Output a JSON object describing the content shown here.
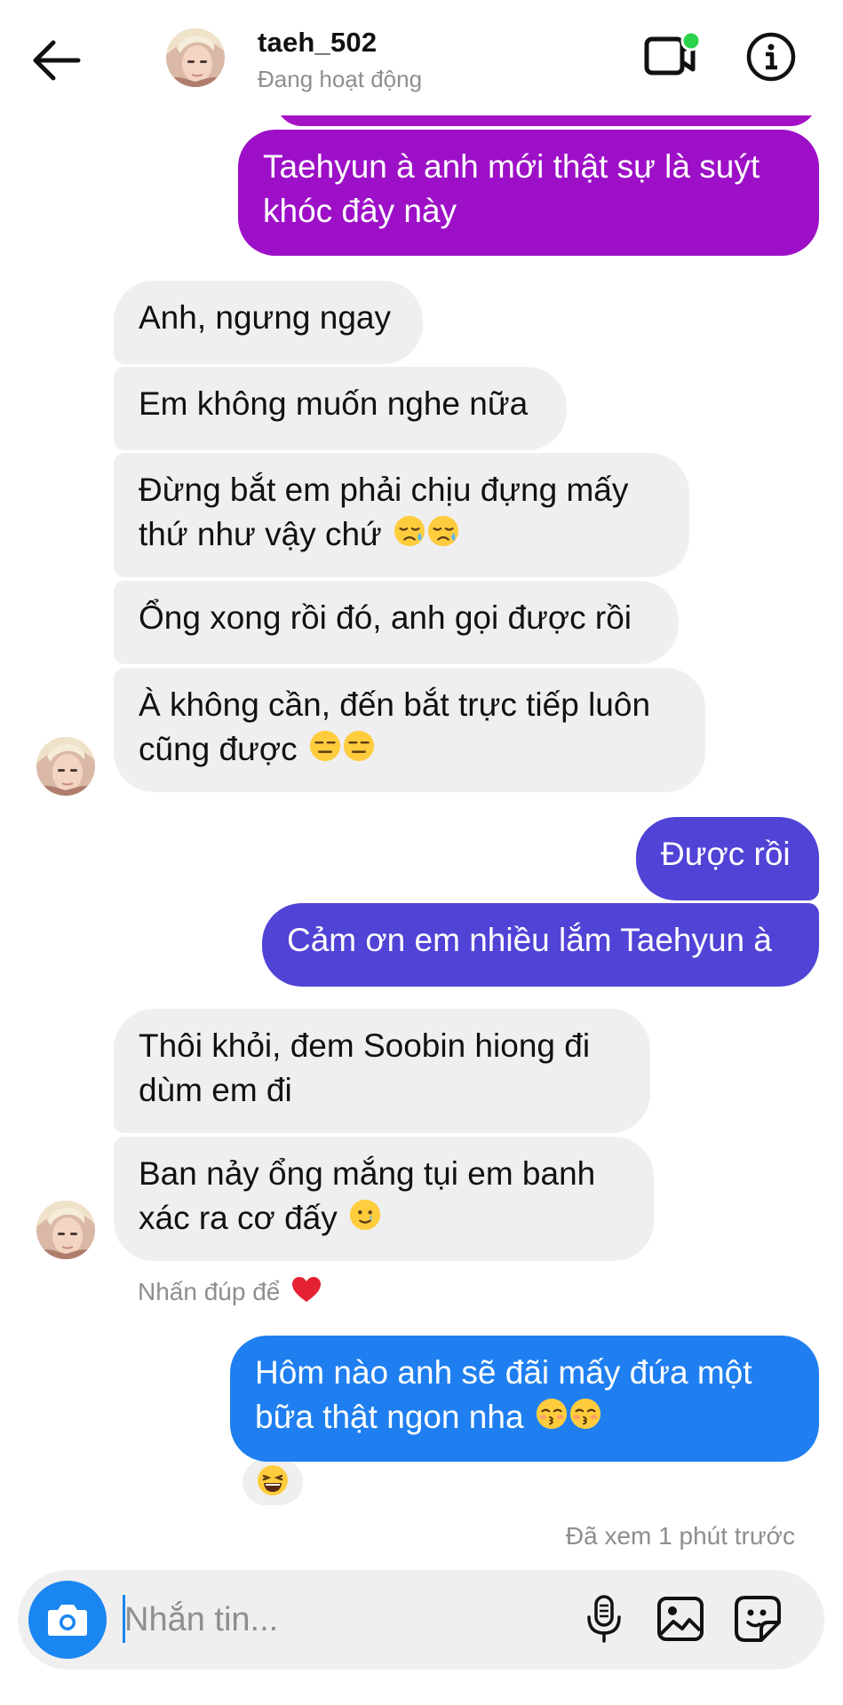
{
  "header": {
    "username": "taeh_502",
    "status": "Đang hoạt động"
  },
  "colors": {
    "incoming": "#efefef",
    "purple": "#9d10c7",
    "indigo": "#5043d6",
    "blue": "#1f7ff0",
    "online_dot": "#2cd34a",
    "camera_button": "#1a86f2"
  },
  "messages": [
    {
      "id": "m1",
      "side": "out",
      "lines": [
        "Taehyun à anh mới thật sự là suýt",
        "khóc đây này"
      ],
      "emoji": []
    },
    {
      "id": "m2",
      "side": "in",
      "lines": [
        "Anh, ngưng ngay"
      ],
      "emoji": []
    },
    {
      "id": "m3",
      "side": "in",
      "lines": [
        "Em không muốn nghe nữa"
      ],
      "emoji": []
    },
    {
      "id": "m4",
      "side": "in",
      "lines": [
        "Đừng bắt em phải chịu đựng mấy",
        "thứ như vậy chứ"
      ],
      "emoji": [
        "sad-sweat-emoji",
        "sad-sweat-emoji"
      ]
    },
    {
      "id": "m5",
      "side": "in",
      "lines": [
        "Ổng xong rồi đó, anh gọi được rồi"
      ],
      "emoji": []
    },
    {
      "id": "m6",
      "side": "in",
      "lines": [
        "À không cần, đến bắt trực tiếp luôn",
        "cũng được"
      ],
      "emoji": [
        "expressionless-emoji",
        "expressionless-emoji"
      ]
    },
    {
      "id": "m7",
      "side": "out",
      "lines": [
        "Được rồi"
      ],
      "emoji": []
    },
    {
      "id": "m8",
      "side": "out",
      "lines": [
        "Cảm ơn em nhiều lắm Taehyun à"
      ],
      "emoji": []
    },
    {
      "id": "m9",
      "side": "in",
      "lines": [
        "Thôi khỏi, đem Soobin hiong đi",
        "dùm em đi"
      ],
      "emoji": []
    },
    {
      "id": "m10",
      "side": "in",
      "lines": [
        "Ban nảy ổng mắng tụi em banh",
        "xác ra cơ đấy"
      ],
      "emoji": [
        "tearful-smile-emoji"
      ]
    },
    {
      "id": "m11",
      "side": "out",
      "lines": [
        "Hôm nào anh sẽ đãi mấy đứa một",
        "bữa thật ngon nha"
      ],
      "emoji": [
        "kissing-emoji",
        "kissing-emoji"
      ]
    }
  ],
  "hint": {
    "text": "Nhấn đúp để",
    "icon": "heart-icon"
  },
  "reaction": {
    "icon": "laughing-emoji"
  },
  "seen": "Đã xem 1 phút trước",
  "composer": {
    "placeholder": "Nhắn tin..."
  }
}
